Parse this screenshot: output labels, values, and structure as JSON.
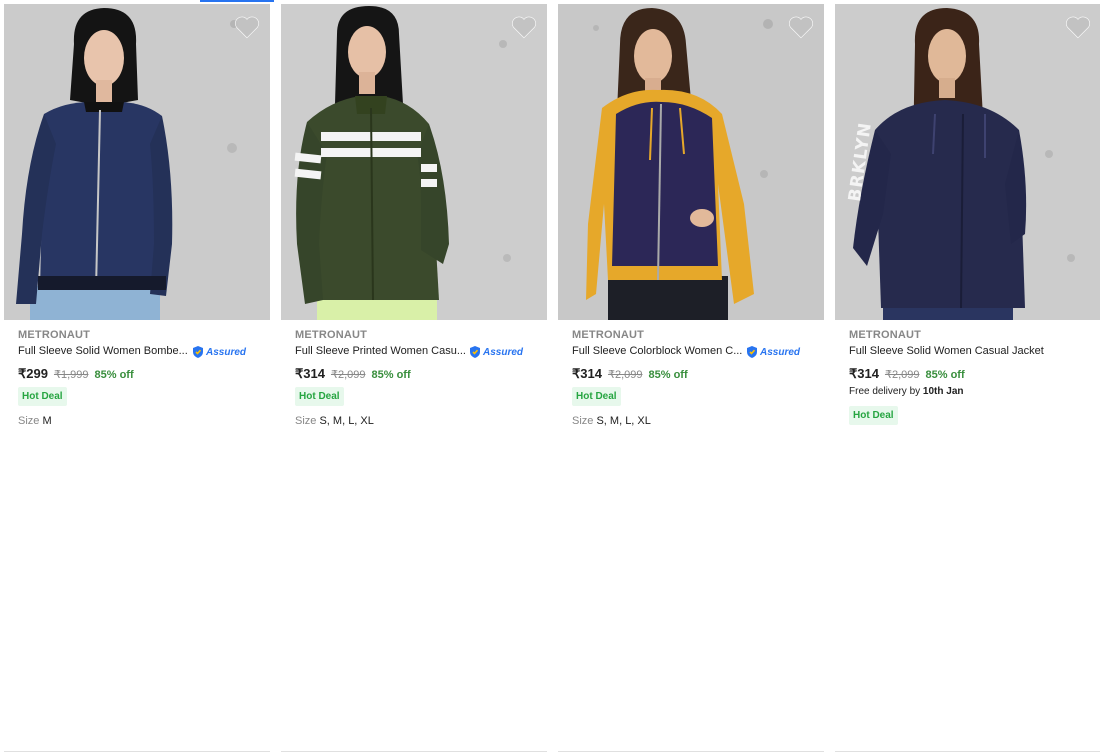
{
  "products": [
    {
      "brand": "METRONAUT",
      "title": "Full Sleeve Solid Women Bombe...",
      "assured": true,
      "assured_label": "Assured",
      "price": "₹299",
      "mrp": "₹1,999",
      "discount": "85% off",
      "deal": "Hot Deal",
      "size_label": "Size",
      "sizes": "M",
      "delivery": null,
      "jacket_color": "#283663",
      "image_bg": "#cbcbcb"
    },
    {
      "brand": "METRONAUT",
      "title": "Full Sleeve Printed Women Casu...",
      "assured": true,
      "assured_label": "Assured",
      "price": "₹314",
      "mrp": "₹2,099",
      "discount": "85% off",
      "deal": "Hot Deal",
      "size_label": "Size",
      "sizes": "S, M, L, XL",
      "delivery": null,
      "jacket_color": "#3b4a2c",
      "image_bg": "#cdcdcd"
    },
    {
      "brand": "METRONAUT",
      "title": "Full Sleeve Colorblock Women C...",
      "assured": true,
      "assured_label": "Assured",
      "price": "₹314",
      "mrp": "₹2,099",
      "discount": "85% off",
      "deal": "Hot Deal",
      "size_label": "Size",
      "sizes": "S, M, L, XL",
      "delivery": null,
      "jacket_color": "#2c2757",
      "accent_color": "#e6a82a",
      "image_bg": "#c8c8c8"
    },
    {
      "brand": "METRONAUT",
      "title": "Full Sleeve Solid Women Casual Jacket",
      "assured": false,
      "price": "₹314",
      "mrp": "₹2,099",
      "discount": "85% off",
      "deal": "Hot Deal",
      "delivery": {
        "prefix": "Free delivery by",
        "date": "10th Jan"
      },
      "sleeve_print": "BRKLYN",
      "jacket_color": "#262a4d",
      "image_bg": "#cccccc"
    }
  ],
  "icons": {
    "wishlist": "heart-icon",
    "assured": "assured-shield-icon"
  },
  "colors": {
    "price_green": "#388e3c",
    "assured_blue": "#2874f0",
    "deal_bg": "#e7f8ec"
  }
}
